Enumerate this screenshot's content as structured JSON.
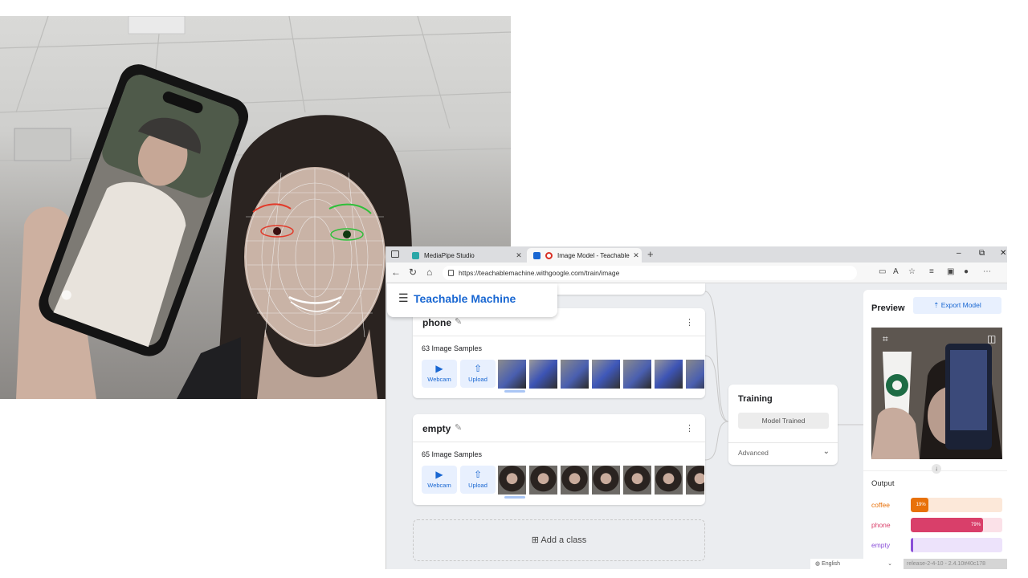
{
  "browser": {
    "tabs": [
      {
        "label": "MediaPipe Studio",
        "active": false,
        "favicon_color": "#2aa7a7"
      },
      {
        "label": "Image Model - Teachable Ma",
        "active": true,
        "favicon_color": "#1967d2"
      }
    ],
    "url": "https://teachablemachine.withgoogle.com/train/image",
    "window_controls": [
      "–",
      "⧉",
      "✕"
    ]
  },
  "app": {
    "brand": "Teachable Machine"
  },
  "classes": [
    {
      "name": "phone",
      "samples_label": "63 Image Samples",
      "webcam_label": "Webcam",
      "upload_label": "Upload",
      "thumb_subject": "phone"
    },
    {
      "name": "empty",
      "samples_label": "65 Image Samples",
      "webcam_label": "Webcam",
      "upload_label": "Upload",
      "thumb_subject": "person"
    }
  ],
  "add_class_label": "Add a class",
  "training": {
    "title": "Training",
    "button_label": "Model Trained",
    "advanced_label": "Advanced"
  },
  "preview": {
    "title": "Preview",
    "export_label": "Export Model",
    "output_label": "Output",
    "outputs": [
      {
        "label": "coffee",
        "percent_text": "19%",
        "value": 19,
        "color": "#e8710a",
        "track": "#fce8d9"
      },
      {
        "label": "phone",
        "percent_text": "79%",
        "value": 79,
        "color": "#d93f6a",
        "track": "#fbe1e8"
      },
      {
        "label": "empty",
        "percent_text": "",
        "value": 2,
        "color": "#8a4fd8",
        "track": "#ede3fb"
      }
    ]
  },
  "footer": {
    "language": "English",
    "release": "release-2-4-10 - 2.4.10#40c178"
  }
}
